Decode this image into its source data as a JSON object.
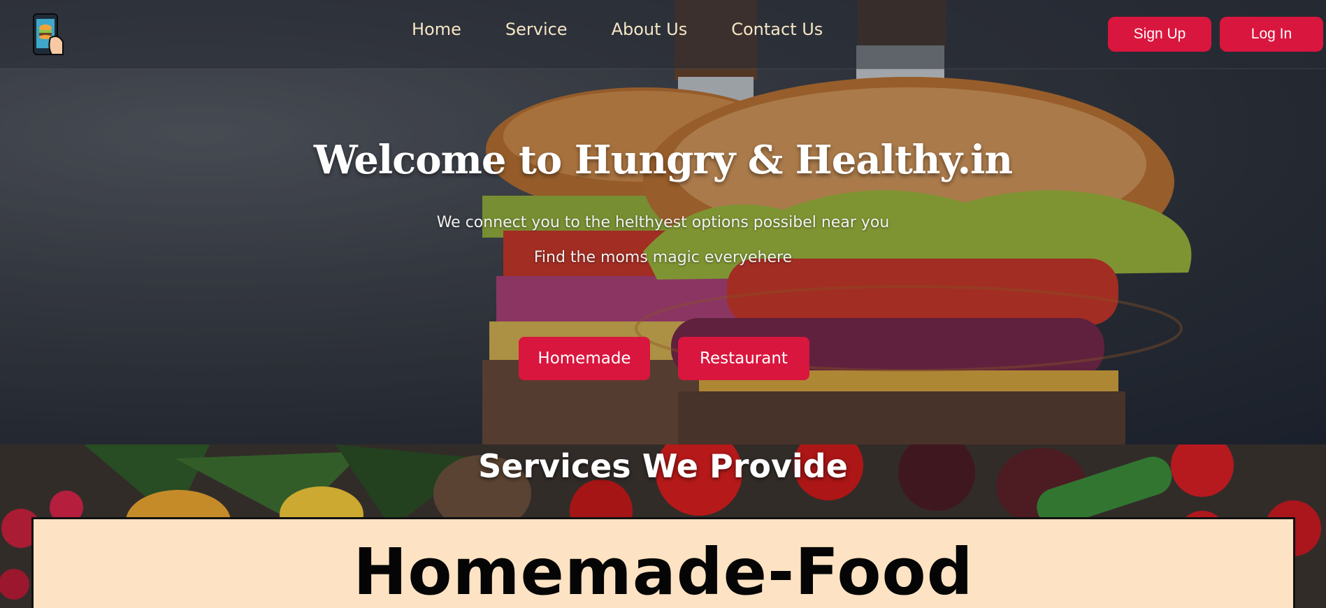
{
  "nav": {
    "logo_icon": "phone-burger-icon",
    "links": [
      "Home",
      "Service",
      "About Us",
      "Contact Us"
    ],
    "signup_label": "Sign Up",
    "login_label": "Log In"
  },
  "hero": {
    "title": "Welcome to Hungry & Healthy.in",
    "subtitle_1": "We connect you to the helthyest options possibel near you",
    "subtitle_2": "Find the moms magic everyehere",
    "cta_homemade": "Homemade",
    "cta_restaurant": "Restaurant"
  },
  "services": {
    "heading": "Services We Provide",
    "card_title": "Homemade-Food"
  },
  "colors": {
    "accent": "#d9163e",
    "nav_text": "#f4e6c5",
    "card_bg": "#fde3c3"
  }
}
